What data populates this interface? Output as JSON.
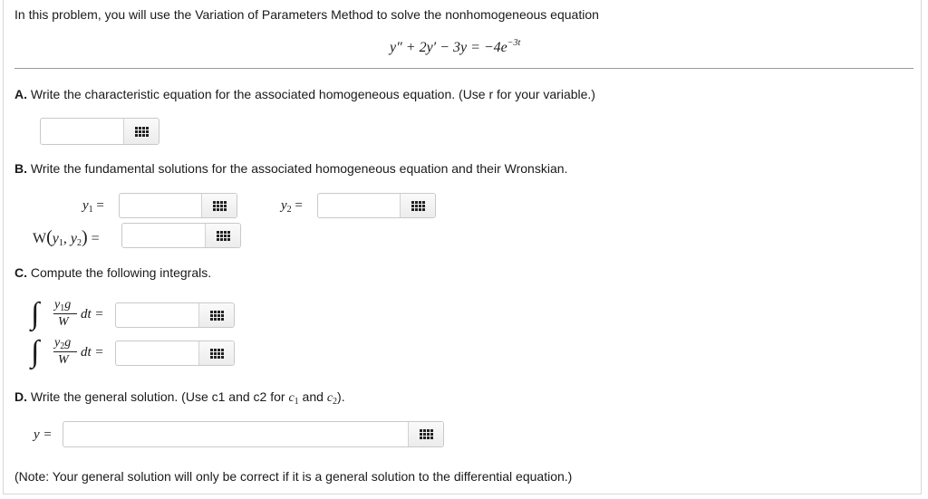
{
  "intro": {
    "text": "In this problem, you will use the Variation of Parameters Method to solve the nonhomogeneous equation",
    "equation_lhs": "y″ + 2y′ − 3y = −4e",
    "equation_exp": "−3t"
  },
  "partA": {
    "letter": "A.",
    "text": "Write the characteristic equation for the associated homogeneous equation. (Use r for your variable.)",
    "answer": ""
  },
  "partB": {
    "letter": "B.",
    "text": "Write the fundamental solutions for the associated homogeneous equation and their Wronskian.",
    "y1_label": "y",
    "y1_sub": "1",
    "y2_label": "y",
    "y2_sub": "2",
    "eq": "=",
    "w_label": "W",
    "w_args": "(y",
    "w_sub1": "1",
    "w_comma": ", y",
    "w_sub2": "2",
    "w_close": ")",
    "y1_answer": "",
    "y2_answer": "",
    "w_answer": ""
  },
  "partC": {
    "letter": "C.",
    "text": "Compute the following integrals.",
    "int1_num": "y",
    "int1_num_sub": "1",
    "int1_g": "g",
    "int2_num": "y",
    "int2_num_sub": "2",
    "int2_g": "g",
    "den": "W",
    "dt": "dt =",
    "int1_answer": "",
    "int2_answer": ""
  },
  "partD": {
    "letter": "D.",
    "text": "Write the general solution. (Use c1 and c2 for ",
    "c1": "c",
    "c1_sub": "1",
    "and": " and ",
    "c2": "c",
    "c2_sub": "2",
    "close": ").",
    "y_label": "y =",
    "answer": ""
  },
  "note": "(Note: Your general solution will only be correct if it is a general solution to the differential equation.)",
  "icons": {
    "keyboard": "keypad-grid-icon"
  }
}
